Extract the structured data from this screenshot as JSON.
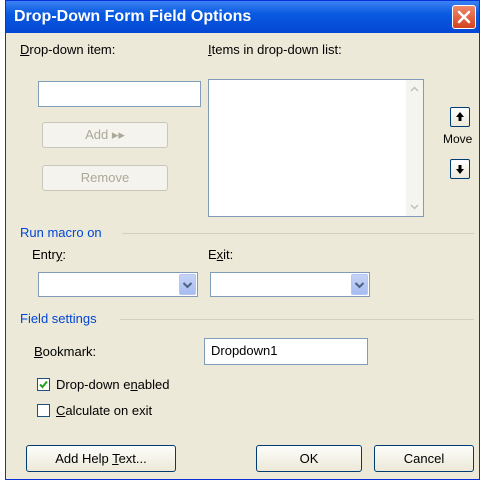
{
  "window": {
    "title": "Drop-Down Form Field Options"
  },
  "items": {
    "dropdown_item_label_pre": "",
    "dropdown_item_label_key": "D",
    "dropdown_item_label_post": "rop-down item:",
    "list_label_key": "I",
    "list_label_post": "tems in drop-down list:",
    "add_label": "Add ▸▸",
    "remove_label": "Remove",
    "move_label": "Move",
    "dropdown_item_value": "",
    "list_items": []
  },
  "run_macro": {
    "section_label": "Run macro on",
    "entry_label_pre": "Entr",
    "entry_label_key": "y",
    "entry_label_post": ":",
    "exit_label_pre": "E",
    "exit_label_key": "x",
    "exit_label_post": "it:",
    "entry_value": "",
    "exit_value": ""
  },
  "field_settings": {
    "section_label": "Field settings",
    "bookmark_label_key": "B",
    "bookmark_label_post": "ookmark:",
    "bookmark_value": "Dropdown1",
    "enabled_label_pre": "Drop-down e",
    "enabled_label_key": "n",
    "enabled_label_post": "abled",
    "enabled_checked": true,
    "calc_label_key": "C",
    "calc_label_post": "alculate on exit",
    "calc_checked": false
  },
  "footer": {
    "help_label_pre": "Add Help ",
    "help_label_key": "T",
    "help_label_post": "ext...",
    "ok_label": "OK",
    "cancel_label": "Cancel"
  }
}
